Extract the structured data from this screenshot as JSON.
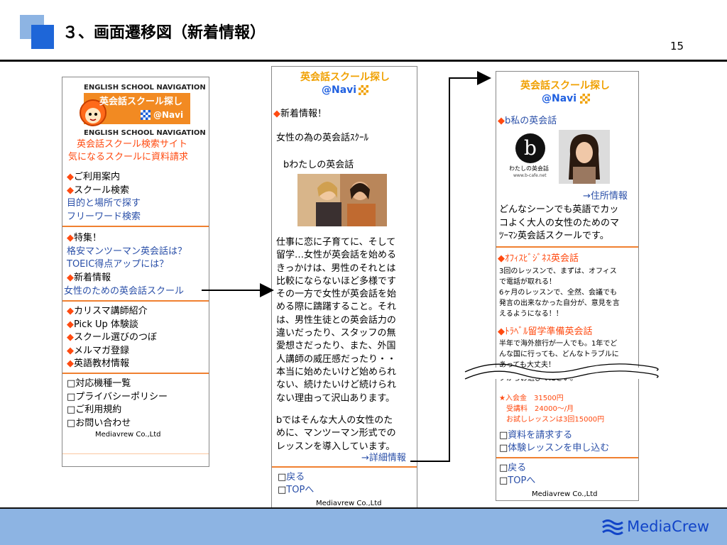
{
  "header": {
    "title": "３、画面遷移図（新着情報）",
    "page_number": "15"
  },
  "footer": {
    "logo": "MediaCrew"
  },
  "screen1": {
    "banner_top": "ENGLISH SCHOOL NAVIGATION",
    "banner_title": "英会話スクール探し",
    "banner_sub": "@Navi",
    "banner_bottom": "ENGLISH SCHOOL NAVIGATION",
    "tagline1": "英会話スクール検索サイト",
    "tagline2": "気になるスクールに資料請求",
    "group1": [
      "ご利用案内",
      "スクール検索"
    ],
    "links1": [
      "目的と場所で探す",
      "フリーワード検索"
    ],
    "feature_heading": "特集！",
    "feature_links": [
      "格安マンツーマン英会話は？",
      "TOEIC得点アップには？"
    ],
    "news_heading": "新着情報",
    "news_link": "女性のための英会話スクール",
    "group3": [
      "カリスマ講師紹介",
      "Pick Up 体験談",
      "スクール選びのつぼ",
      "メルマガ登録",
      "英語教材情報"
    ],
    "group4": [
      "□対応機種一覧",
      "□プライバシーポリシー",
      "□ご利用規約",
      "□お問い合わせ"
    ],
    "company": "Mediavrew Co.,Ltd"
  },
  "screen2": {
    "logo_title": "英会話スクール探し",
    "logo_sub": "@Navi",
    "heading": "新着情報！",
    "subtitle": "女性の為の英会話ｽｸｰﾙ",
    "school_name": "bわたしの英会話",
    "paragraph1": [
      "仕事に恋に子育てに、そして",
      "留学…女性が英会話を始める",
      "きっかけは、男性のそれとは",
      "比較にならないほど多様です",
      "その一方で女性が英会話を始",
      "める際に躊躇すること。それ",
      "は、男性生徒との英会話力の",
      "違いだったり、スタッフの無",
      "愛想さだったり、また、外国",
      "人講師の威圧感だったり・・",
      "本当に始めたいけど始められ",
      "ない、続けたいけど続けられ",
      "ない理由って沢山あります。"
    ],
    "paragraph2": [
      "bではそんな大人の女性のた",
      "めに、マンツーマン形式での",
      "レッスンを導入しています。"
    ],
    "detail_link": "→詳細情報",
    "back_link": "戻る",
    "top_link": "TOPへ",
    "company": "Mediavrew Co.,Ltd"
  },
  "screen3": {
    "logo_title": "英会話スクール探し",
    "logo_sub": "@Navi",
    "heading": "b私の英会話",
    "logo_caption": "わたしの英会話",
    "logo_url": "www.b-cafe.net",
    "address_link": "→住所情報",
    "intro": [
      "どんなシーンでも英語でカッ",
      "コよく大人の女性のためのマ",
      "ﾂｰﾏﾝ英会話スクールです。"
    ],
    "course1_title": "ｵﾌｨｽﾋﾞｼﾞﾈｽ英会話",
    "course1_text": [
      "3回のレッスンで、まずは、オフィス",
      "で電話が取れる！",
      "6ヶ月のレッスンで、全然、会議でも",
      "発言の出来なかった自分が、意見を言",
      "えるようになる！！"
    ],
    "course2_title": "ﾄﾗﾍﾞﾙ留学準備英会話",
    "course2_text": [
      "半年で海外旅行が一人でも。1年でど",
      "んな国に行っても、どんなトラブルに",
      "あっても大丈夫！"
    ],
    "cut_text": "クからお選びください。",
    "fees": [
      "★入会金　31500円",
      "　受講料　24000～/月",
      "　お試しレッスンは3回15000円"
    ],
    "links": [
      "資料を請求する",
      "体験レッスンを申し込む"
    ],
    "back_link": "戻る",
    "top_link": "TOPへ",
    "company": "Mediavrew Co.,Ltd"
  },
  "colors": {
    "accent_orange": "#f08030",
    "link_blue": "#2a4fa8",
    "footer_blue": "#8db4e3"
  }
}
